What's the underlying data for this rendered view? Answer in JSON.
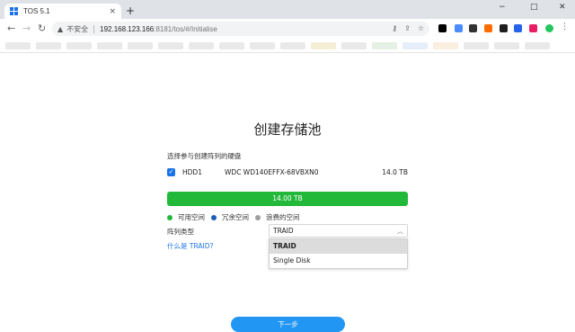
{
  "browser": {
    "tab_title": "TOS 5.1",
    "tab_close": "×",
    "new_tab": "+",
    "window_controls": {
      "minimize": "−",
      "maximize": "□",
      "close": "✕"
    },
    "nav": {
      "back": "←",
      "forward": "→",
      "reload": "↻"
    },
    "address": {
      "security_icon": "warning-icon",
      "security_label": "不安全",
      "host": "192.168.123.166",
      "path": ":8181/tos/#/Initialise"
    },
    "extension_colors": [
      "#000000",
      "#4a8cff",
      "#333333",
      "#ff6d00",
      "#1e1e1e",
      "#2563eb",
      "#e91e63",
      "#22c55e",
      "#555555",
      "#888888"
    ]
  },
  "page": {
    "title": "创建存储池",
    "select_disks_label": "选择参与创建阵列的硬盘",
    "disks": [
      {
        "checked": true,
        "name": "HDD1",
        "model": "WDC WD140EFFX-68VBXN0",
        "size": "14.0 TB"
      }
    ],
    "capacity_bar": {
      "label": "14.00 TB",
      "available_fraction": 1.0,
      "color": "#22b83a"
    },
    "legend": [
      {
        "label": "可用空间",
        "color": "#22b83a"
      },
      {
        "label": "冗余空间",
        "color": "#1a5fb4"
      },
      {
        "label": "浪费的空间",
        "color": "#9e9e9e"
      }
    ],
    "raid_type_label": "阵列类型",
    "raid_select_value": "TRAID",
    "raid_options": [
      "TRAID",
      "Single Disk"
    ],
    "help_link": "什么是 TRAID?",
    "next_button": "下一步"
  }
}
